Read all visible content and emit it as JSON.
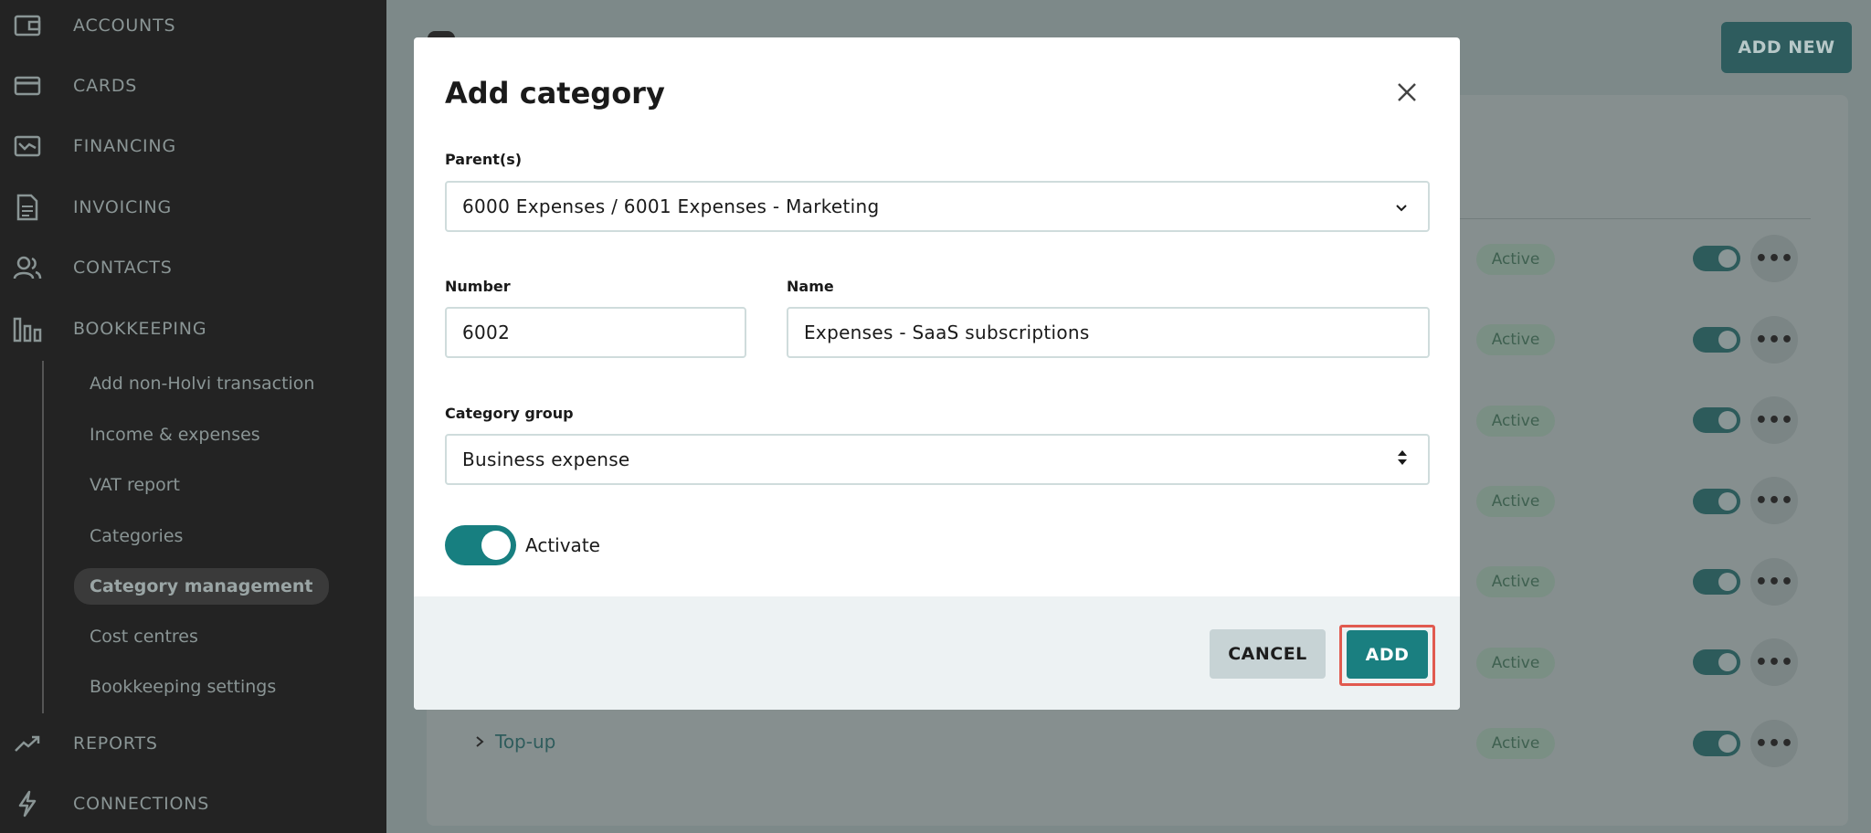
{
  "sidebar": {
    "items": [
      {
        "label": "ACCOUNTS",
        "icon": "wallet-icon"
      },
      {
        "label": "CARDS",
        "icon": "card-icon"
      },
      {
        "label": "FINANCING",
        "icon": "financing-icon"
      },
      {
        "label": "INVOICING",
        "icon": "document-icon"
      },
      {
        "label": "CONTACTS",
        "icon": "contacts-icon"
      },
      {
        "label": "BOOKKEEPING",
        "icon": "bar-chart-icon"
      },
      {
        "label": "REPORTS",
        "icon": "trend-icon"
      },
      {
        "label": "CONNECTIONS",
        "icon": "bolt-icon"
      }
    ],
    "bookkeeping_subitems": [
      "Add non-Holvi transaction",
      "Income & expenses",
      "VAT report",
      "Categories",
      "Category management",
      "Cost centres",
      "Bookkeeping settings"
    ],
    "active_subitem": "Category management"
  },
  "background": {
    "add_new_label": "ADD NEW",
    "status_badge": "Active",
    "row_link": "Top-up"
  },
  "modal": {
    "title": "Add category",
    "parent_label": "Parent(s)",
    "parent_value": "6000 Expenses / 6001 Expenses - Marketing",
    "number_label": "Number",
    "number_value": "6002",
    "name_label": "Name",
    "name_value": "Expenses - SaaS subscriptions",
    "group_label": "Category group",
    "group_value": "Business expense",
    "activate_label": "Activate",
    "activate_on": true,
    "cancel_label": "CANCEL",
    "add_label": "ADD"
  },
  "colors": {
    "accent": "#1a7f80",
    "highlight": "#e15a4f",
    "sidebar": "#232323"
  }
}
